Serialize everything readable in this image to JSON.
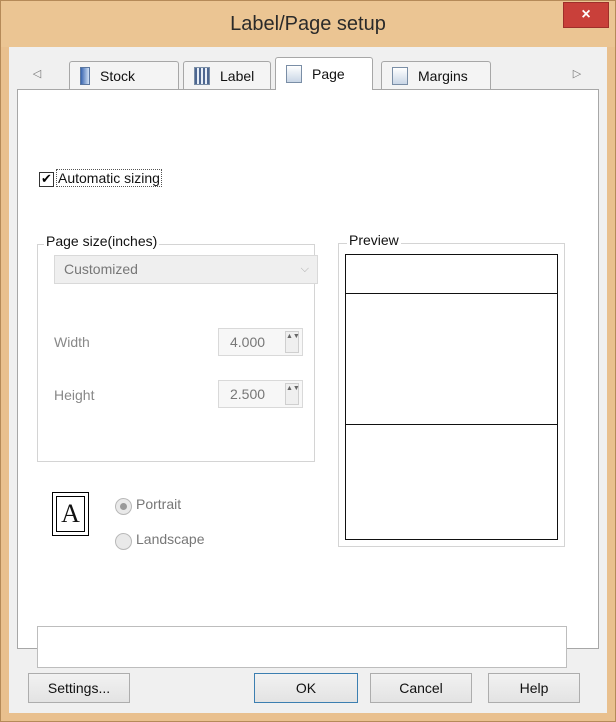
{
  "window": {
    "title": "Label/Page setup",
    "close_glyph": "×"
  },
  "tabs": [
    {
      "label": "Stock",
      "icon": "stock-icon"
    },
    {
      "label": "Label",
      "icon": "label-icon"
    },
    {
      "label": "Page",
      "icon": "page-icon",
      "active": true
    },
    {
      "label": "Margins",
      "icon": "margins-icon"
    }
  ],
  "tab_scroll": {
    "left": "◁",
    "right": "▷"
  },
  "automatic_sizing": {
    "label": "Automatic sizing",
    "checked": true,
    "check_glyph": "✔"
  },
  "page_size": {
    "group_label": "Page size(inches)",
    "combo_value": "Customized",
    "combo_arrow": "⌵",
    "width_label": "Width",
    "width_value": "4.000",
    "height_label": "Height",
    "height_value": "2.500",
    "spin_glyphs": "▲▼"
  },
  "orientation": {
    "icon_letter": "A",
    "portrait_label": "Portrait",
    "landscape_label": "Landscape",
    "selected": "Portrait"
  },
  "preview": {
    "group_label": "Preview"
  },
  "buttons": {
    "settings": "Settings...",
    "ok": "OK",
    "cancel": "Cancel",
    "help": "Help"
  },
  "colors": {
    "title_bar": "#ebc593",
    "close_button": "#c9403a",
    "default_button_border": "#3c7fb1"
  }
}
